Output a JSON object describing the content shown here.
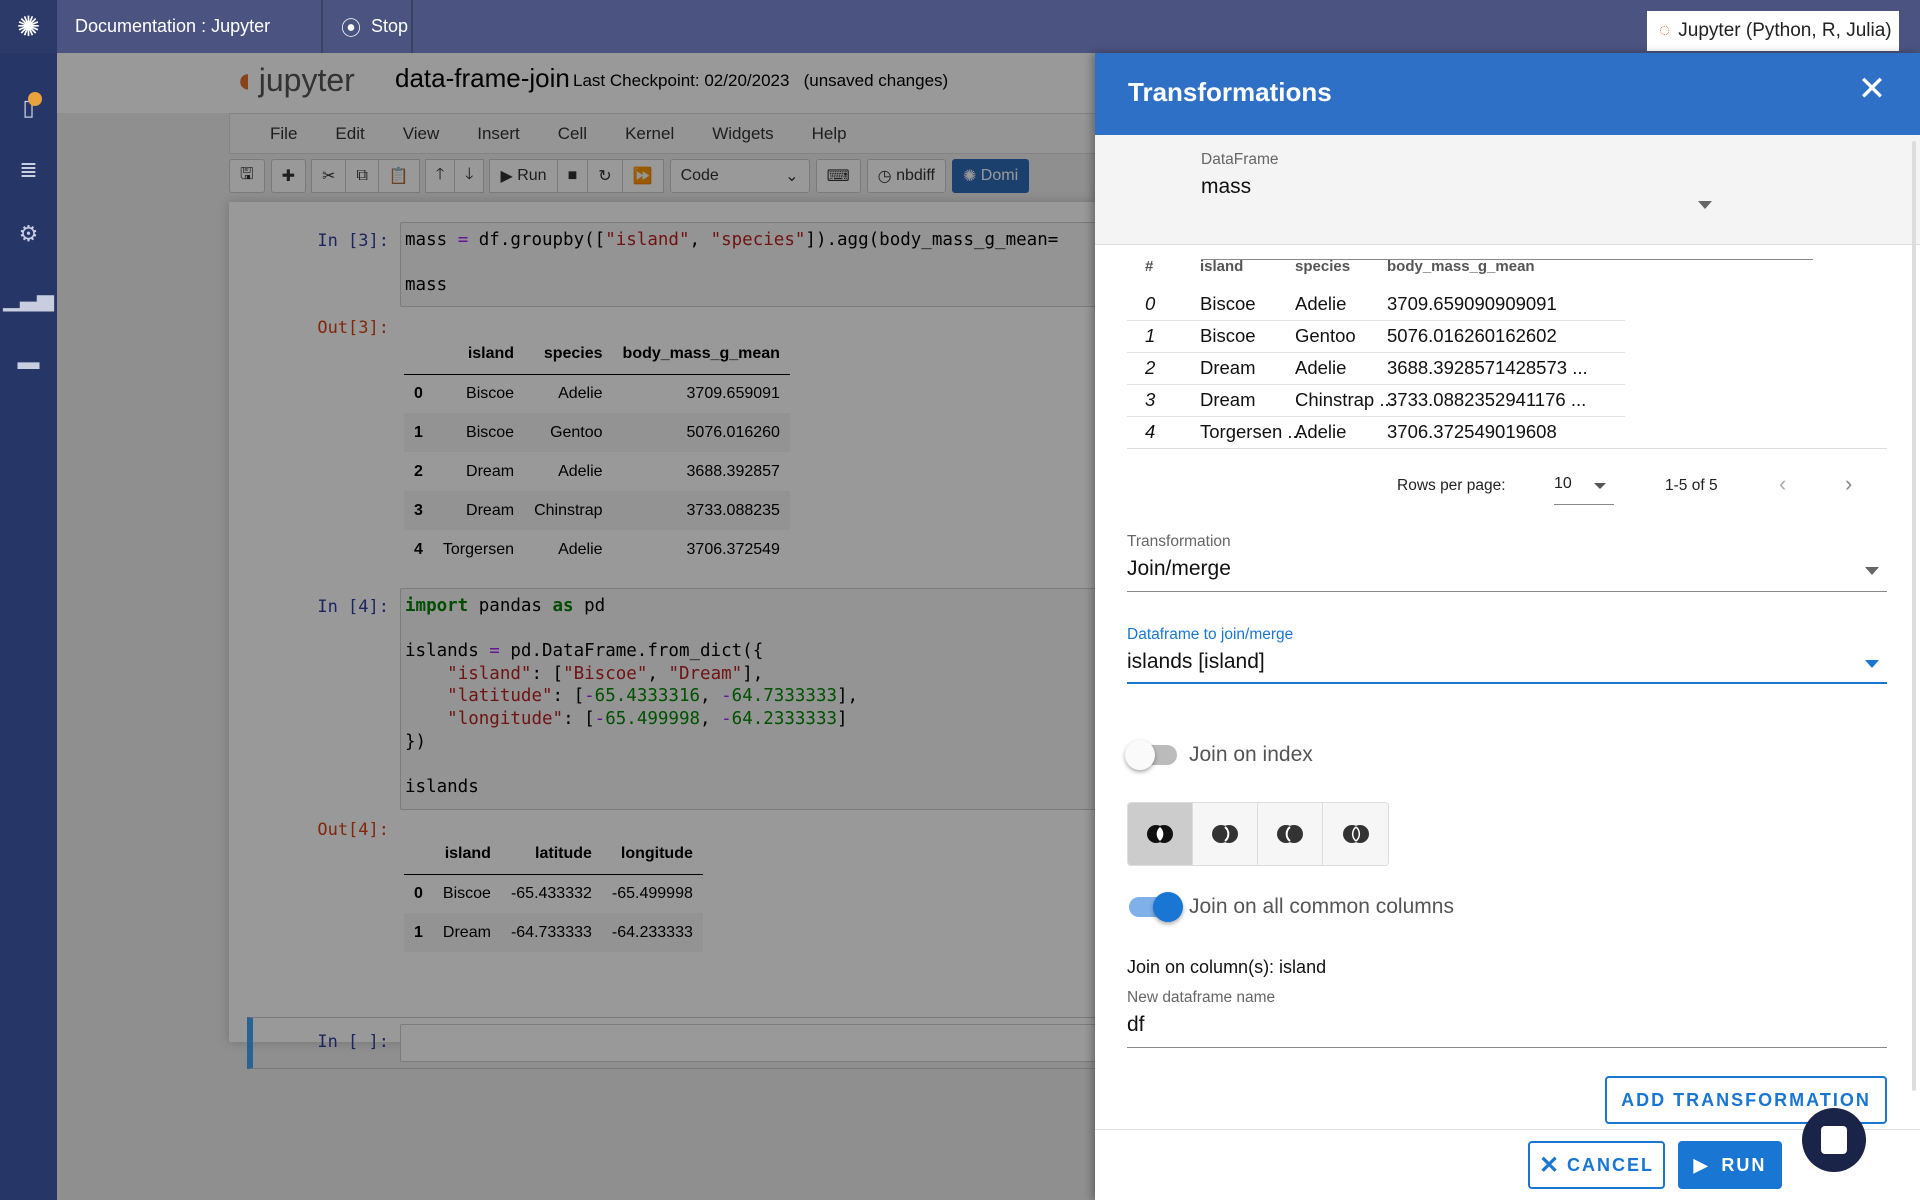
{
  "topbar": {
    "tab_title": "Documentation : Jupyter",
    "stop_label": "Stop",
    "kernel_label": "Jupyter (Python, R, Julia)"
  },
  "sidebar": {
    "items": [
      {
        "icon": "file-icon",
        "badge": true
      },
      {
        "icon": "database-icon"
      },
      {
        "icon": "gear-icon"
      },
      {
        "icon": "bar-chart-icon"
      },
      {
        "icon": "card-icon"
      }
    ]
  },
  "notebook": {
    "logo_text": "jupyter",
    "title": "data-frame-join",
    "checkpoint": "Last Checkpoint: 02/20/2023",
    "status": "(unsaved changes)",
    "menu": [
      "File",
      "Edit",
      "View",
      "Insert",
      "Cell",
      "Kernel",
      "Widgets",
      "Help"
    ],
    "toolbar": {
      "run_label": "Run",
      "cell_type": "Code",
      "nbdiff_label": "nbdiff",
      "domino_label": "Domi"
    },
    "cells": [
      {
        "in_prompt": "In [3]:",
        "out_prompt": "Out[3]:",
        "code_line1": "mass = df.groupby([\"island\", \"species\"]).agg(body_mass_g_mean=",
        "code_line2": "mass",
        "table": {
          "columns": [
            "",
            "island",
            "species",
            "body_mass_g_mean"
          ],
          "rows": [
            [
              "0",
              "Biscoe",
              "Adelie",
              "3709.659091"
            ],
            [
              "1",
              "Biscoe",
              "Gentoo",
              "5076.016260"
            ],
            [
              "2",
              "Dream",
              "Adelie",
              "3688.392857"
            ],
            [
              "3",
              "Dream",
              "Chinstrap",
              "3733.088235"
            ],
            [
              "4",
              "Torgersen",
              "Adelie",
              "3706.372549"
            ]
          ]
        }
      },
      {
        "in_prompt": "In [4]:",
        "out_prompt": "Out[4]:",
        "table": {
          "columns": [
            "",
            "island",
            "latitude",
            "longitude"
          ],
          "rows": [
            [
              "0",
              "Biscoe",
              "-65.433332",
              "-65.499998"
            ],
            [
              "1",
              "Dream",
              "-64.733333",
              "-64.233333"
            ]
          ]
        }
      },
      {
        "in_prompt": "In [ ]:"
      }
    ]
  },
  "panel": {
    "title": "Transformations",
    "dataframe_label": "DataFrame",
    "dataframe_value": "mass",
    "preview": {
      "columns": [
        "#",
        "island",
        "species",
        "body_mass_g_mean"
      ],
      "rows": [
        [
          "0",
          "Biscoe",
          "Adelie",
          "3709.659090909091"
        ],
        [
          "1",
          "Biscoe",
          "Gentoo",
          "5076.016260162602"
        ],
        [
          "2",
          "Dream",
          "Adelie",
          "3688.3928571428573 ..."
        ],
        [
          "3",
          "Dream",
          "Chinstrap ...",
          "3733.0882352941176 ..."
        ],
        [
          "4",
          "Torgersen ...",
          "Adelie",
          "3706.372549019608"
        ]
      ]
    },
    "rows_per_page_label": "Rows per page:",
    "rows_per_page": "10",
    "page_range": "1-5 of 5",
    "transformation_label": "Transformation",
    "transformation_value": "Join/merge",
    "join_df_label": "Dataframe to join/merge",
    "join_df_value": "islands [island]",
    "join_on_index_label": "Join on index",
    "join_on_index": false,
    "join_types": [
      "inner",
      "left",
      "right",
      "outer"
    ],
    "selected_join": "inner",
    "join_common_label": "Join on all common columns",
    "join_common": true,
    "join_columns_text": "Join on column(s): island",
    "new_name_label": "New dataframe name",
    "new_name_value": "df",
    "add_label": "ADD TRANSFORMATION",
    "cancel_label": "CANCEL",
    "run_label": "RUN",
    "accent": "#2e70c6"
  }
}
